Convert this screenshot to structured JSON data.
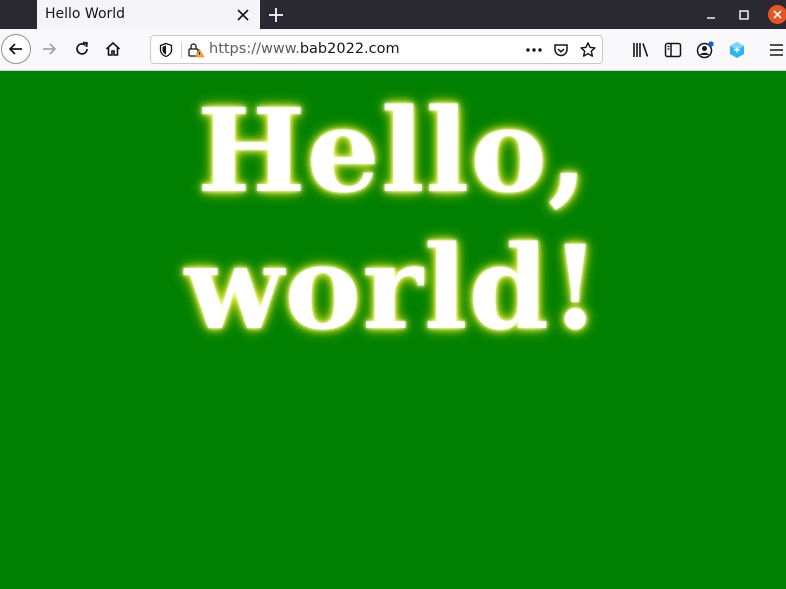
{
  "browser": {
    "tab": {
      "title": "Hello World"
    },
    "url": {
      "scheme_prefix": "https://www.",
      "host": "bab2022.com"
    },
    "colors": {
      "tabstrip_bg": "#2b2a33",
      "window_close": "#e95420",
      "extension_accent": "#29b6f6"
    }
  },
  "page": {
    "headline": "Hello, world!",
    "background_color": "#008000",
    "text_color": "#ffffff",
    "glow_color": "#ffff66"
  }
}
